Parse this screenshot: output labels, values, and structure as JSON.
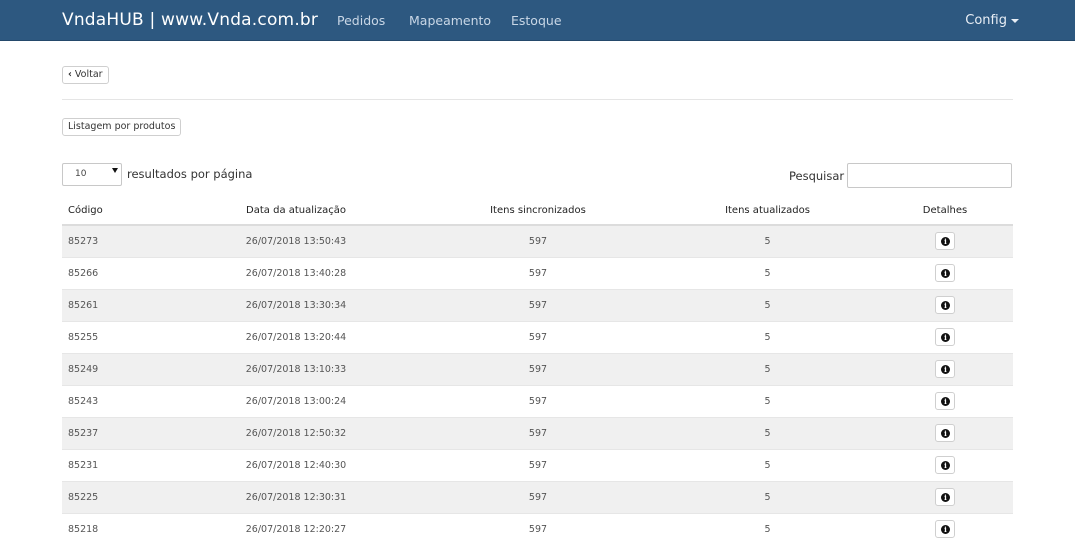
{
  "header": {
    "brand": "VndaHUB  | www.Vnda.com.br",
    "nav": [
      {
        "label": "Pedidos"
      },
      {
        "label": "Mapeamento"
      },
      {
        "label": "Estoque"
      }
    ],
    "config_label": "Config"
  },
  "actions": {
    "back_label": "Voltar",
    "list_products_label": "Listagem por produtos"
  },
  "table_controls": {
    "page_size_value": "10",
    "page_size_suffix": "resultados por página",
    "search_label": "Pesquisar",
    "search_value": ""
  },
  "table": {
    "columns": [
      "Código",
      "Data da atualização",
      "Itens sincronizados",
      "Itens atualizados",
      "Detalhes"
    ],
    "rows": [
      [
        "85273",
        "26/07/2018 13:50:43",
        "597",
        "5"
      ],
      [
        "85266",
        "26/07/2018 13:40:28",
        "597",
        "5"
      ],
      [
        "85261",
        "26/07/2018 13:30:34",
        "597",
        "5"
      ],
      [
        "85255",
        "26/07/2018 13:20:44",
        "597",
        "5"
      ],
      [
        "85249",
        "26/07/2018 13:10:33",
        "597",
        "5"
      ],
      [
        "85243",
        "26/07/2018 13:00:24",
        "597",
        "5"
      ],
      [
        "85237",
        "26/07/2018 12:50:32",
        "597",
        "5"
      ],
      [
        "85231",
        "26/07/2018 12:40:30",
        "597",
        "5"
      ],
      [
        "85225",
        "26/07/2018 12:30:31",
        "597",
        "5"
      ],
      [
        "85218",
        "26/07/2018 12:20:27",
        "597",
        "5"
      ]
    ]
  },
  "icons": {
    "back": "chevron-left-icon",
    "config": "caret-down-icon",
    "page_size": "select-arrow-icon",
    "details": "info-icon"
  },
  "colors": {
    "navbar": "#2d5880",
    "striped_row": "#f0f0f0"
  }
}
